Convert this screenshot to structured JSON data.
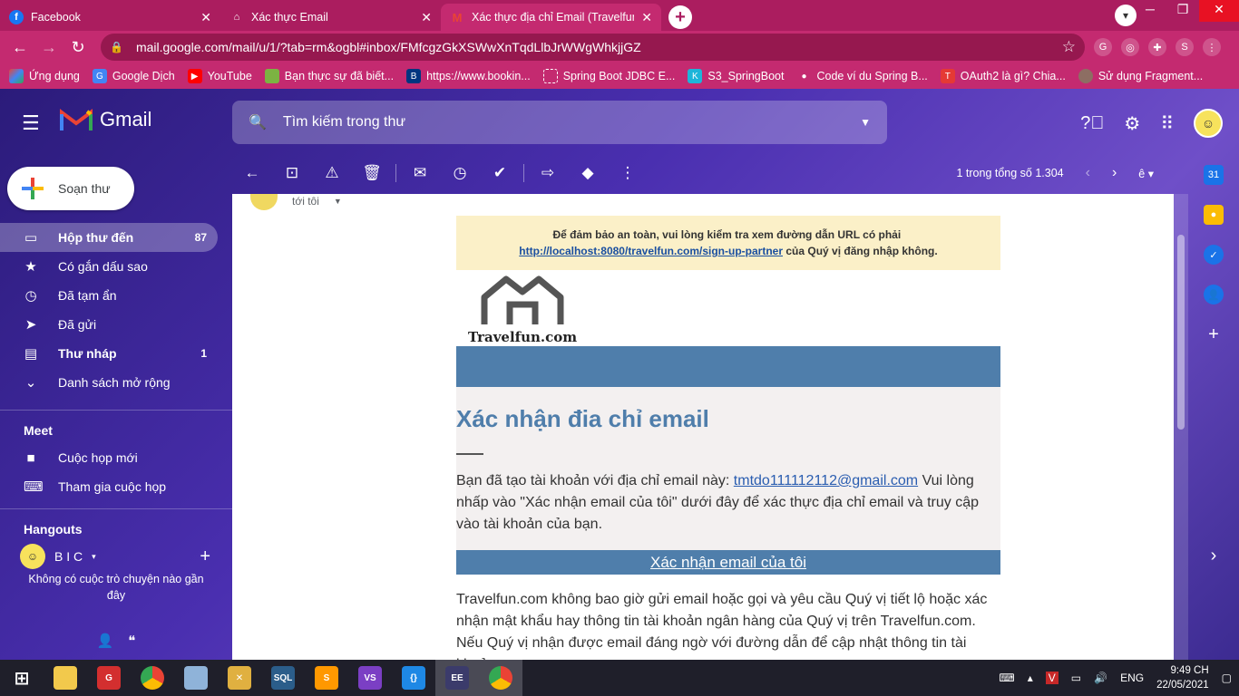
{
  "browser": {
    "tabs": [
      {
        "title": "Facebook",
        "icon": "facebook-icon",
        "color": "#1877f2"
      },
      {
        "title": "Xác thực Email",
        "icon": "house-icon",
        "color": "#ffffff"
      },
      {
        "title": "Xác thực địa chỉ Email (Travelfun",
        "icon": "gmail-icon",
        "color": "#ea4335"
      }
    ],
    "url": "mail.google.com/mail/u/1/?tab=rm&ogbl#inbox/FMfcgzGkXSWwXnTqdLlbJrWWgWhkjjGZ",
    "profile_initial": "S",
    "bookmarks": [
      "Ứng dụng",
      "Google Dịch",
      "YouTube",
      "Bạn thực sự đã biết...",
      "https://www.bookin...",
      "Spring Boot JDBC E...",
      "S3_SpringBoot",
      "Code ví du Spring B...",
      "OAuth2 là gì? Chia...",
      "Sử dụng Fragment..."
    ]
  },
  "gmail": {
    "brand": "Gmail",
    "search_placeholder": "Tìm kiếm trong thư",
    "compose_label": "Soạn thư",
    "sidebar": [
      {
        "label": "Hộp thư đến",
        "count": "87",
        "icon": "inbox-icon"
      },
      {
        "label": "Có gắn dấu sao",
        "count": "",
        "icon": "star-icon"
      },
      {
        "label": "Đã tạm ẩn",
        "count": "",
        "icon": "clock-icon"
      },
      {
        "label": "Đã gửi",
        "count": "",
        "icon": "send-icon"
      },
      {
        "label": "Thư nháp",
        "count": "1",
        "icon": "draft-icon"
      },
      {
        "label": "Danh sách mở rộng",
        "count": "",
        "icon": "chevron-down-icon"
      }
    ],
    "meet": {
      "title": "Meet",
      "new_meeting": "Cuộc họp mới",
      "join_meeting": "Tham gia cuộc họp"
    },
    "hangouts": {
      "title": "Hangouts",
      "user": "B I C",
      "no_chats": "Không có cuộc trò chuyện nào gần đây"
    },
    "pager": "1 trong tổng số 1.304",
    "sender_to": "tới tôi"
  },
  "email": {
    "notice_text": "Để đảm bảo an toàn, vui lòng kiểm tra xem đường dẫn URL có phải",
    "notice_link": "http://localhost:8080/travelfun.com/sign-up-partner",
    "notice_suffix": "của Quý vị đăng nhập không.",
    "brand_name": "Travelfun.com",
    "heading": "Xác nhận đia chỉ email",
    "body_prefix": "Bạn đã tạo tài khoản với địa chỉ email này:",
    "body_email": "tmtdo111112112@gmail.com",
    "body_suffix": "Vui lòng nhấp vào \"Xác nhận email của tôi\" dưới đây để xác thực địa chỉ email và truy cập vào tài khoản của bạn.",
    "cta": "Xác nhận email của tôi",
    "footer": "Travelfun.com không bao giờ gửi email hoặc gọi và yêu cầu Quý vị tiết lộ hoặc xác nhận mật khẩu hay thông tin tài khoản ngân hàng của Quý vị trên Travelfun.com. Nếu Quý vị nhận được email đáng ngờ với đường dẫn để cập nhật thông tin tài khoản"
  },
  "taskbar": {
    "lang": "ENG",
    "time": "9:49 CH",
    "date": "22/05/2021"
  }
}
